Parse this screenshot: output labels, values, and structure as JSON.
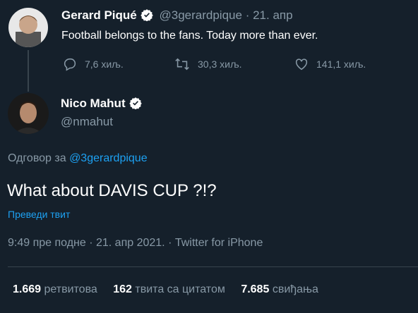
{
  "quoted_tweet": {
    "author_name": "Gerard Piqué",
    "author_handle": "@3gerardpique",
    "separator": "·",
    "date": "21. апр",
    "text": "Football belongs to the fans. Today more than ever.",
    "replies": "7,6 хиљ.",
    "retweets": "30,3 хиљ.",
    "likes": "141,1 хиљ."
  },
  "main_tweet": {
    "author_name": "Nico Mahut",
    "author_handle": "@nmahut",
    "reply_prefix": "Одговор за",
    "reply_to": "@3gerardpique",
    "text": "What about DAVIS CUP ?!?",
    "translate_label": "Преведи твит",
    "timestamp": "9:49 пре подне · 21. апр 2021. · Twitter for iPhone"
  },
  "stats": {
    "retweets_count": "1.669",
    "retweets_label": "ретвитова",
    "quotes_count": "162",
    "quotes_label": "твита са цитатом",
    "likes_count": "7.685",
    "likes_label": "свиђања"
  },
  "colors": {
    "background": "#15202b",
    "accent": "#1da1f2",
    "muted": "#8899a6",
    "divider": "#38444d"
  }
}
